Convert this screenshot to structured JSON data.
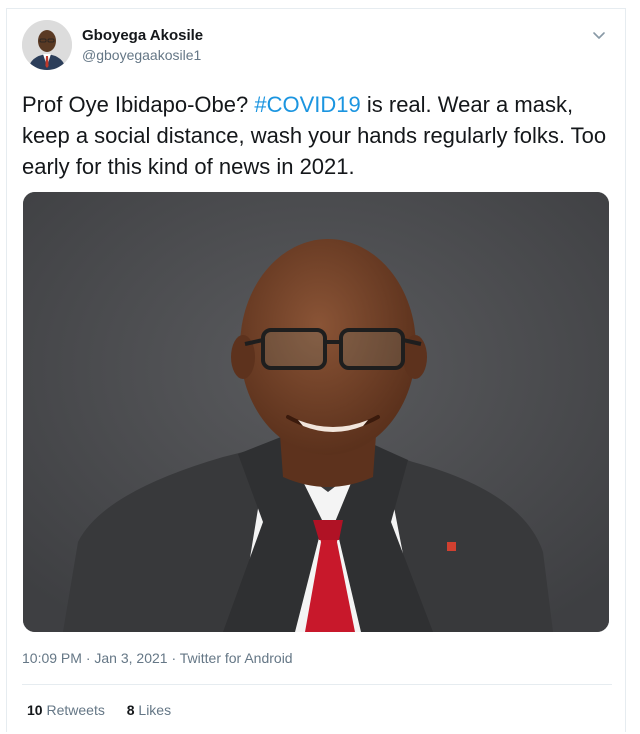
{
  "tweet": {
    "author": {
      "display_name": "Gboyega Akosile",
      "handle": "@gboyegaakosile1"
    },
    "text_before": "Prof Oye Ibidapo-Obe? ",
    "hashtag": "#COVID19",
    "text_after": " is real. Wear a mask, keep a social distance, wash your hands regularly folks. Too early for this kind of news in 2021.",
    "time": "10:09 PM",
    "date": "Jan 3, 2021",
    "source": "Twitter for Android",
    "retweets_count": "10",
    "retweets_label": "Retweets",
    "likes_count": "8",
    "likes_label": "Likes"
  },
  "icons": {
    "caret": "chevron-down-icon"
  },
  "colors": {
    "hashtag": "#1b95e0",
    "secondary_text": "#657786",
    "primary_text": "#14171a",
    "photo_background": "#4a4b4e"
  }
}
